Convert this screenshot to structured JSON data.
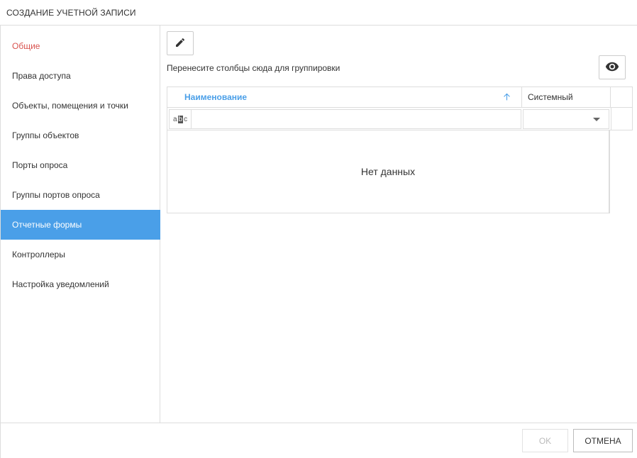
{
  "dialog": {
    "title": "СОЗДАНИЕ УЧЕТНОЙ ЗАПИСИ"
  },
  "sidebar": {
    "items": [
      {
        "label": "Общие",
        "state": "red"
      },
      {
        "label": "Права доступа",
        "state": "normal"
      },
      {
        "label": "Объекты, помещения и точки",
        "state": "normal"
      },
      {
        "label": "Группы объектов",
        "state": "normal"
      },
      {
        "label": "Порты опроса",
        "state": "normal"
      },
      {
        "label": "Группы портов опроса",
        "state": "normal"
      },
      {
        "label": "Отчетные формы",
        "state": "active"
      },
      {
        "label": "Контроллеры",
        "state": "normal"
      },
      {
        "label": "Настройка уведомлений",
        "state": "normal"
      }
    ]
  },
  "toolbar": {
    "edit_icon": "pencil-icon",
    "visibility_icon": "eye-icon"
  },
  "grid": {
    "group_panel_text": "Перенесите столбцы сюда для группировки",
    "columns": [
      {
        "label": "Наименование",
        "sort": "ascending"
      },
      {
        "label": "Системный"
      }
    ],
    "filter": {
      "name_value": "",
      "system_value": ""
    },
    "no_data_text": "Нет данных"
  },
  "footer": {
    "ok_label": "OK",
    "cancel_label": "ОТМЕНА"
  },
  "colors": {
    "accent": "#4a9fe8",
    "warning_text": "#d9534f",
    "border": "#dddddd"
  }
}
